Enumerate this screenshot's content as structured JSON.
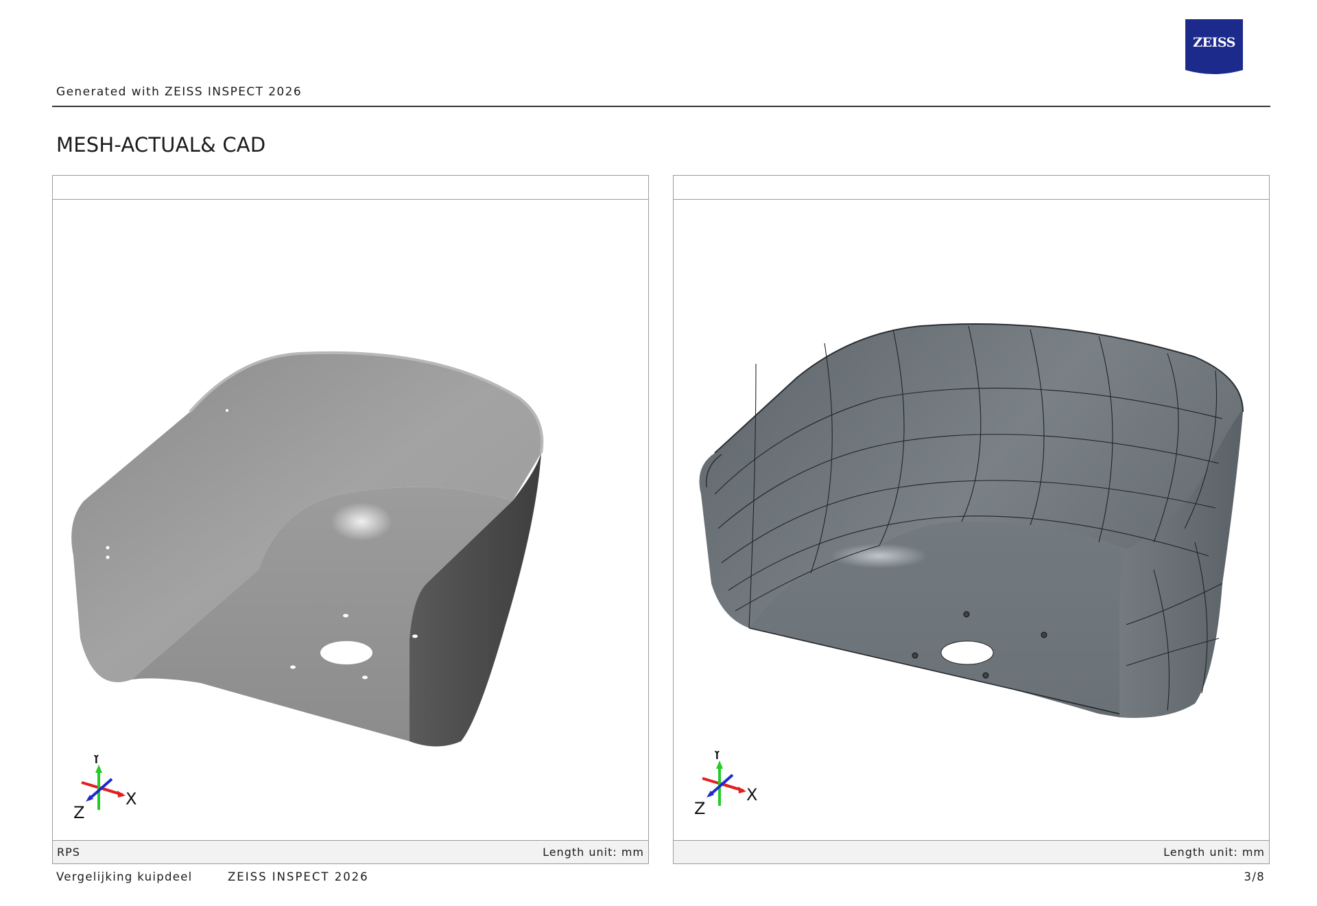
{
  "header": {
    "generated_text": "Generated with ZEISS INSPECT 2026",
    "logo_text": "ZEISS",
    "logo_color": "#1c2a8c"
  },
  "page": {
    "title": "MESH-ACTUAL& CAD"
  },
  "panels": [
    {
      "content": "scan mesh view",
      "footer_left": "RPS",
      "footer_right": "Length unit: mm",
      "axes": {
        "x": "X",
        "y": "Y",
        "z": "Z"
      }
    },
    {
      "content": "CAD model view",
      "footer_left": "",
      "footer_right": "Length unit: mm",
      "axes": {
        "x": "X",
        "y": "Y",
        "z": "Z"
      }
    }
  ],
  "footer": {
    "document_name": "Vergelijking kuipdeel",
    "app_name": "ZEISS INSPECT 2026",
    "page_number": "3/8"
  },
  "colors": {
    "axis_x": "#e02020",
    "axis_y": "#22cc22",
    "axis_z": "#1a2ad0"
  }
}
